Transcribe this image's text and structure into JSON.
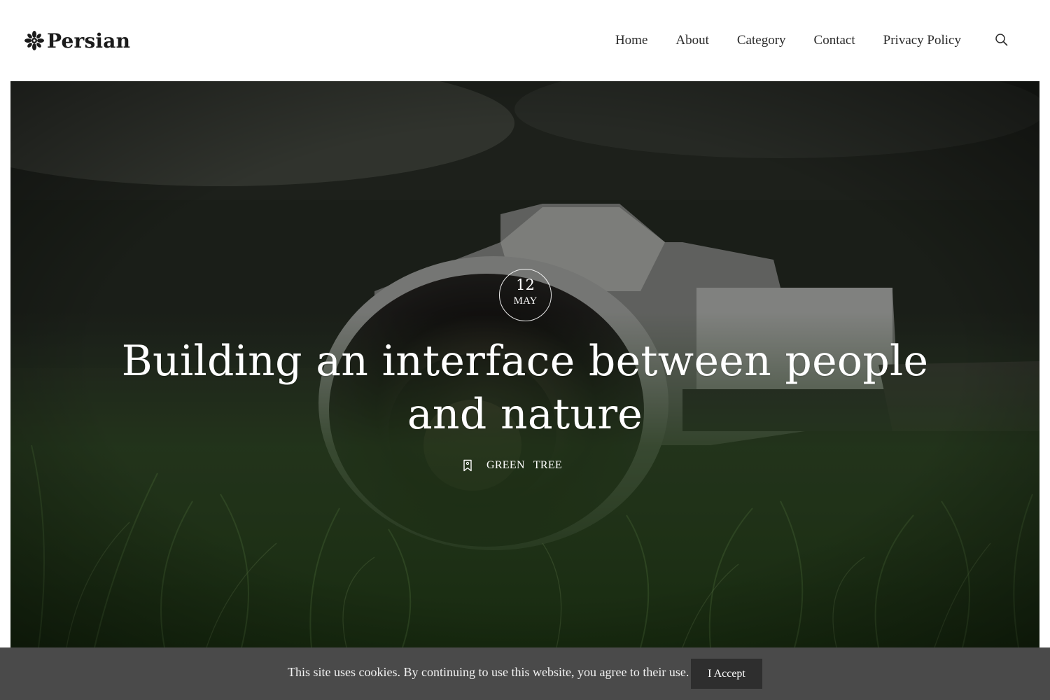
{
  "site": {
    "logo_text": "Persian",
    "logo_icon": "leaf-ornament-icon"
  },
  "nav": {
    "items": [
      {
        "label": "Home"
      },
      {
        "label": "About"
      },
      {
        "label": "Category"
      },
      {
        "label": "Contact"
      },
      {
        "label": "Privacy Policy"
      }
    ],
    "search_icon": "search-icon"
  },
  "hero": {
    "date": {
      "day": "12",
      "month": "MAY"
    },
    "title": "Building an interface between people and nature",
    "tag_icon": "bookmark-icon",
    "tags": [
      "GREEN",
      "TREE"
    ]
  },
  "cookie": {
    "text": "This site uses cookies. By continuing to use this website, you agree to their use.",
    "button": "I Accept"
  }
}
